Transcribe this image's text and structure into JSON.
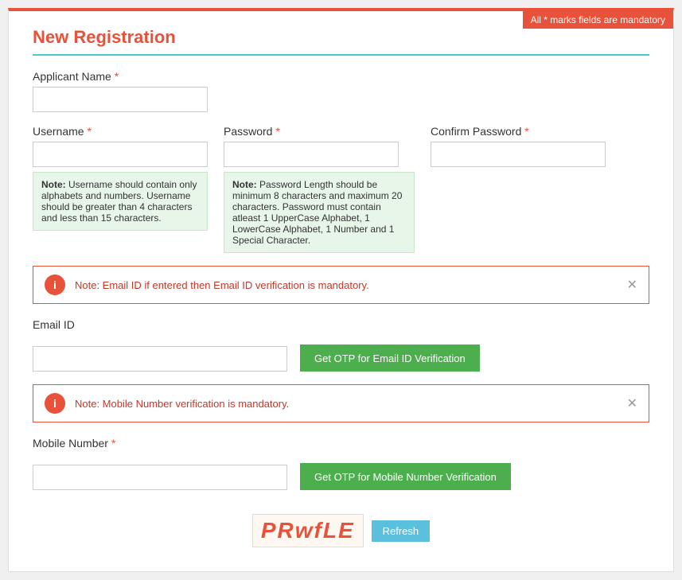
{
  "page": {
    "title": "New Registration",
    "mandatory_note": "All * marks fields are mandatory",
    "fields": {
      "applicant_name": {
        "label": "Applicant Name",
        "required": true,
        "placeholder": ""
      },
      "username": {
        "label": "Username",
        "required": true,
        "placeholder": "",
        "note_title": "Note:",
        "note_text": "Username should contain only alphabets and numbers. Username should be greater than 4 characters and less than 15 characters."
      },
      "password": {
        "label": "Password",
        "required": true,
        "placeholder": "",
        "note_title": "Note:",
        "note_text": "Password Length should be minimum 8 characters and maximum 20 characters. Password must contain atleast 1 UpperCase Alphabet, 1 LowerCase Alphabet, 1 Number and 1 Special Character."
      },
      "confirm_password": {
        "label": "Confirm Password",
        "required": true,
        "placeholder": ""
      },
      "email_id": {
        "label": "Email ID",
        "required": false,
        "placeholder": ""
      },
      "mobile_number": {
        "label": "Mobile Number",
        "required": true,
        "placeholder": ""
      }
    },
    "alerts": {
      "email_alert": "Note: Email ID if entered then Email ID verification is mandatory.",
      "mobile_alert": "Note: Mobile Number verification is mandatory."
    },
    "buttons": {
      "get_otp_email": "Get OTP for Email ID Verification",
      "get_otp_mobile": "Get OTP for Mobile Number Verification",
      "refresh": "Refresh"
    },
    "captcha": {
      "text": "PRwfLE"
    }
  }
}
